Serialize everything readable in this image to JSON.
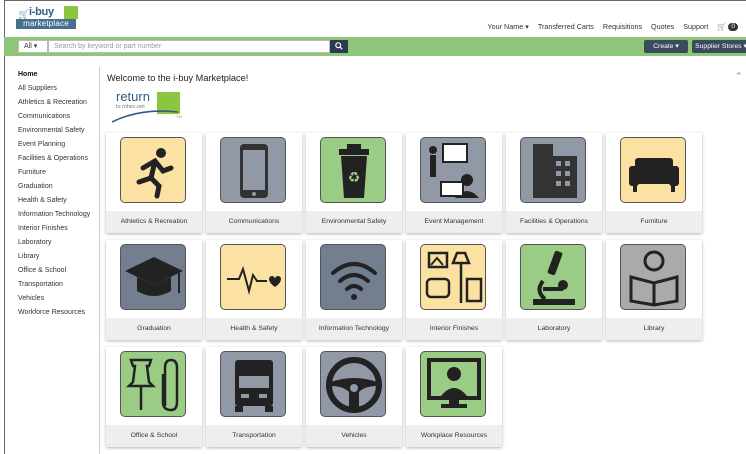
{
  "logo": {
    "line1": "i-buy",
    "line2": "marketplace"
  },
  "topnav": {
    "user": "Your Name ▾",
    "transferred_carts": "Transferred Carts",
    "requisitions": "Requisitions",
    "quotes": "Quotes",
    "support": "Support",
    "cart_count": "0"
  },
  "search": {
    "scope": "All ▾",
    "placeholder": "Search by keyword or part number",
    "create": "Create ▾",
    "supplier_stores": "Supplier Stores ▾"
  },
  "sidebar": {
    "items": [
      "Home",
      "All Suppliers",
      "Athletics & Recreation",
      "Communications",
      "Environmental Safety",
      "Event Planning",
      "Facilities & Operations",
      "Furniture",
      "Graduation",
      "Health & Safety",
      "Information Technology",
      "Interior Finishes",
      "Laboratory",
      "Library",
      "Office & School",
      "Transportation",
      "Vehicles",
      "Workforce Resources"
    ]
  },
  "main": {
    "welcome": "Welcome to the i-buy Marketplace!",
    "return_word": "return",
    "return_sub": "to mhec.net",
    "return_tm": "TM"
  },
  "categories": [
    {
      "label": "Athletics & Recreation",
      "icon": "running-person-icon",
      "color": "#fce2a2"
    },
    {
      "label": "Communications",
      "icon": "smartphone-icon",
      "color": "#9199a6"
    },
    {
      "label": "Environmental Safety",
      "icon": "recycling-bin-icon",
      "color": "#9bcc85"
    },
    {
      "label": "Event Management",
      "icon": "presentation-icon",
      "color": "#9199a6"
    },
    {
      "label": "Facilities & Operations",
      "icon": "building-icon",
      "color": "#9199a6"
    },
    {
      "label": "Furniture",
      "icon": "sofa-icon",
      "color": "#fce2a2"
    },
    {
      "label": "Graduation",
      "icon": "graduation-cap-icon",
      "color": "#737e8f"
    },
    {
      "label": "Health & Safety",
      "icon": "heartbeat-icon",
      "color": "#fce2a2"
    },
    {
      "label": "Information Technology",
      "icon": "wifi-icon",
      "color": "#737e8f"
    },
    {
      "label": "Interior Finishes",
      "icon": "interior-furniture-icon",
      "color": "#fce2a2"
    },
    {
      "label": "Laboratory",
      "icon": "microscope-icon",
      "color": "#9bcc85"
    },
    {
      "label": "Library",
      "icon": "reading-person-icon",
      "color": "#aaaaaa"
    },
    {
      "label": "Office & School",
      "icon": "pushpin-paperclip-icon",
      "color": "#9bcc85"
    },
    {
      "label": "Transportation",
      "icon": "truck-icon",
      "color": "#9199a6"
    },
    {
      "label": "Vehicles",
      "icon": "steering-wheel-icon",
      "color": "#9199a6"
    },
    {
      "label": "Workplace Resources",
      "icon": "monitor-user-icon",
      "color": "#9bcc85"
    }
  ]
}
